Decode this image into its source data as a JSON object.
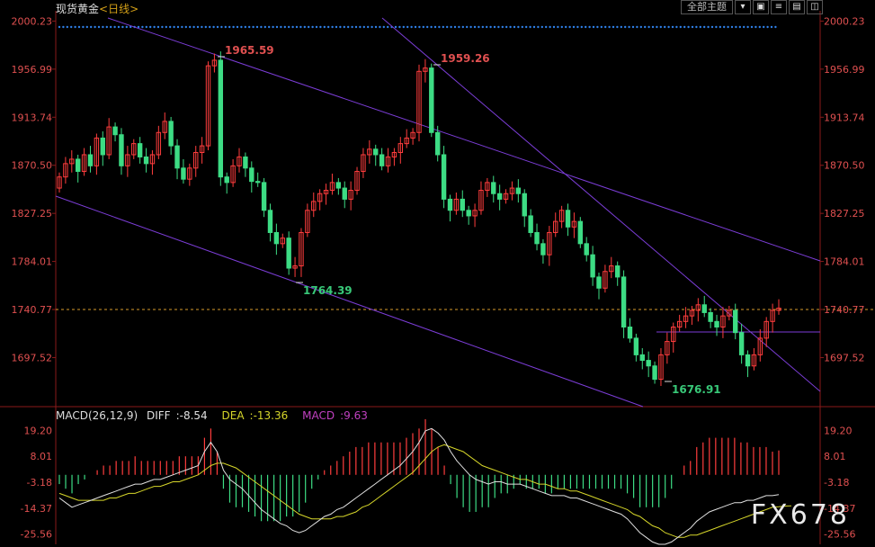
{
  "header": {
    "symbol": "现货黄金",
    "period": "<日线>"
  },
  "toolbar": {
    "select_label": "全部主题",
    "buttons": [
      "▾",
      "▣",
      "≡",
      "▤",
      "◫"
    ]
  },
  "chart_data": [
    {
      "type": "candlestick",
      "title": "",
      "y_ticks": [
        "2000.23",
        "1956.99",
        "1913.74",
        "1870.50",
        "1827.25",
        "1784.01",
        "1740.77",
        "1697.52"
      ],
      "current_price_label": "1740.77",
      "annotations": [
        {
          "label": "1965.59",
          "value": 1965.59,
          "kind": "high"
        },
        {
          "label": "1959.26",
          "value": 1959.26,
          "kind": "high"
        },
        {
          "label": "1764.39",
          "value": 1764.39,
          "kind": "low"
        },
        {
          "label": "1676.91",
          "value": 1676.91,
          "kind": "low"
        }
      ],
      "close_series": [
        1860,
        1872,
        1876,
        1865,
        1880,
        1870,
        1895,
        1880,
        1905,
        1898,
        1870,
        1880,
        1890,
        1878,
        1872,
        1880,
        1900,
        1910,
        1888,
        1868,
        1858,
        1868,
        1882,
        1888,
        1960,
        1965,
        1860,
        1855,
        1870,
        1878,
        1868,
        1856,
        1855,
        1830,
        1810,
        1800,
        1805,
        1778,
        1780,
        1810,
        1830,
        1838,
        1845,
        1848,
        1855,
        1850,
        1840,
        1848,
        1865,
        1880,
        1885,
        1880,
        1870,
        1878,
        1882,
        1890,
        1895,
        1900,
        1955,
        1958,
        1900,
        1880,
        1840,
        1830,
        1840,
        1830,
        1825,
        1830,
        1848,
        1855,
        1845,
        1840,
        1845,
        1850,
        1845,
        1825,
        1810,
        1800,
        1790,
        1810,
        1820,
        1830,
        1815,
        1820,
        1800,
        1790,
        1770,
        1760,
        1775,
        1780,
        1770,
        1725,
        1715,
        1700,
        1695,
        1690,
        1678,
        1700,
        1712,
        1725,
        1730,
        1735,
        1740,
        1745,
        1738,
        1730,
        1725,
        1735,
        1740,
        1720,
        1700,
        1690,
        1700,
        1715,
        1730,
        1740,
        1742
      ],
      "ma_lines": "not shown",
      "grid": false,
      "xlabel": "",
      "ylabel": ""
    },
    {
      "type": "bar+line",
      "title": "MACD(26,12,9)",
      "legend": [
        {
          "name": "DIFF",
          "value": "-8.54",
          "color": "#e0e0e0"
        },
        {
          "name": "DEA",
          "value": "-13.36",
          "color": "#d6d62a"
        },
        {
          "name": "MACD",
          "value": "9.63",
          "color": "#c040c0"
        }
      ],
      "y_ticks": [
        "19.20",
        "8.01",
        "-3.18",
        "-14.37",
        "-25.56"
      ],
      "y_range": [
        -30,
        24
      ],
      "diff_series": [
        -10,
        -12,
        -14,
        -13,
        -12,
        -11,
        -10,
        -9,
        -8,
        -7,
        -6,
        -5,
        -4,
        -4,
        -3,
        -2,
        -2,
        -1,
        0,
        1,
        2,
        3,
        4,
        10,
        14,
        10,
        2,
        -2,
        -4,
        -6,
        -9,
        -12,
        -15,
        -17,
        -19,
        -21,
        -22,
        -24,
        -25,
        -24,
        -22,
        -20,
        -18,
        -17,
        -15,
        -14,
        -12,
        -10,
        -8,
        -6,
        -4,
        -2,
        0,
        2,
        4,
        7,
        10,
        14,
        19,
        20,
        18,
        15,
        10,
        6,
        3,
        0,
        -2,
        -3,
        -4,
        -3,
        -3,
        -4,
        -4,
        -4,
        -5,
        -6,
        -7,
        -8,
        -9,
        -9,
        -9,
        -10,
        -10,
        -11,
        -12,
        -13,
        -14,
        -15,
        -16,
        -17,
        -19,
        -22,
        -25,
        -27,
        -29,
        -30,
        -30,
        -29,
        -27,
        -25,
        -23,
        -20,
        -18,
        -16,
        -15,
        -14,
        -13,
        -12,
        -12,
        -11,
        -11,
        -10,
        -9,
        -9,
        -8.54
      ],
      "dea_series": [
        -8,
        -9,
        -10,
        -11,
        -11,
        -11,
        -11,
        -11,
        -10,
        -10,
        -9,
        -8,
        -8,
        -7,
        -6,
        -5,
        -5,
        -4,
        -3,
        -3,
        -2,
        -1,
        0,
        2,
        4,
        5,
        5,
        4,
        3,
        1,
        -1,
        -3,
        -5,
        -7,
        -9,
        -11,
        -13,
        -15,
        -17,
        -18,
        -19,
        -19,
        -19,
        -19,
        -18,
        -18,
        -17,
        -16,
        -14,
        -13,
        -11,
        -9,
        -7,
        -5,
        -3,
        -1,
        1,
        4,
        7,
        10,
        12,
        13,
        12,
        11,
        10,
        8,
        6,
        4,
        3,
        2,
        1,
        0,
        -1,
        -2,
        -2,
        -3,
        -4,
        -4,
        -5,
        -6,
        -6,
        -7,
        -7,
        -8,
        -9,
        -10,
        -11,
        -12,
        -13,
        -14,
        -15,
        -17,
        -18,
        -20,
        -22,
        -23,
        -25,
        -26,
        -27,
        -27,
        -26,
        -26,
        -25,
        -24,
        -23,
        -22,
        -21,
        -20,
        -19,
        -18,
        -17,
        -16,
        -15,
        -14,
        -13.8,
        -13.5,
        -13.36
      ]
    }
  ],
  "colors": {
    "up": "#ff3d3d",
    "down": "#3ddc84",
    "price_text": "#e05050",
    "low_text": "#38c878",
    "trend": "#7b3dd6",
    "dashed": "#d79b2c",
    "dots": "#2f7fe6"
  },
  "watermark": "FX678"
}
